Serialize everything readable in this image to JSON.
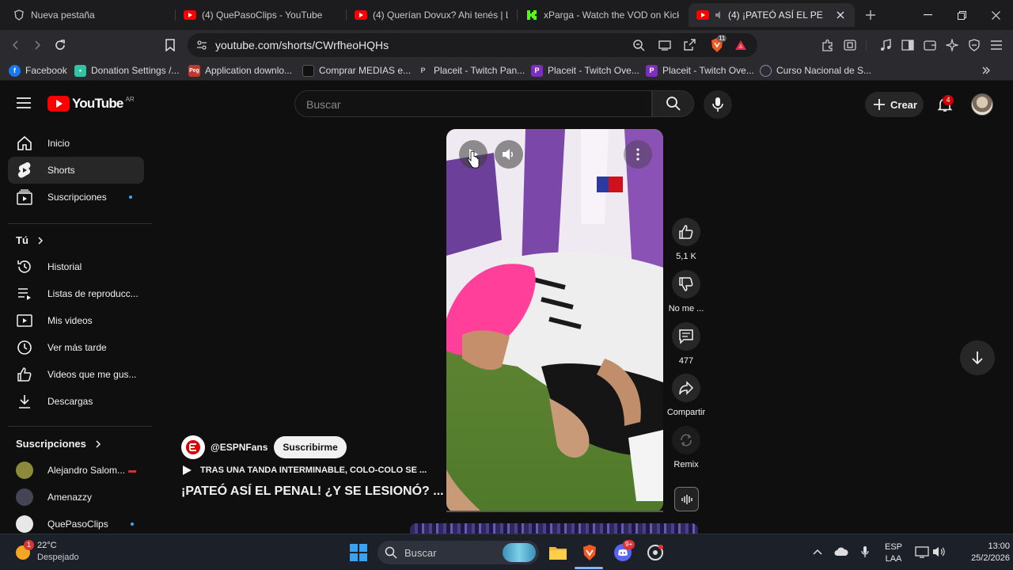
{
  "browser": {
    "tabs": [
      {
        "title": "Nueva pestaña",
        "favicon": "brave-shield-icon"
      },
      {
        "title": "(4) QuePasoClips - YouTube",
        "favicon": "youtube-icon"
      },
      {
        "title": "(4) Querían Dovux? Ahi tenés | La",
        "favicon": "youtube-icon"
      },
      {
        "title": "xParga - Watch the VOD on Kick",
        "favicon": "kick-icon"
      },
      {
        "title": "(4) ¡PATEÓ ASÍ EL PENAL!",
        "favicon": "youtube-icon",
        "active": true
      }
    ],
    "url": "youtube.com/shorts/CWrfheoHQHs",
    "brave_badge": "11",
    "bookmarks": [
      {
        "label": "Facebook",
        "icon": "facebook-icon",
        "color": "#1877f2"
      },
      {
        "label": "Donation Settings /...",
        "icon": "streamlabs-icon",
        "color": "#31c3a2"
      },
      {
        "label": "Application downlo...",
        "icon": "peg-icon",
        "color": "#c0392b"
      },
      {
        "label": "Comprar MEDIAS e...",
        "icon": "store-icon",
        "color": "#222222"
      },
      {
        "label": "Placeit - Twitch Pan...",
        "icon": "placeit-icon",
        "color": "#3a3a3a"
      },
      {
        "label": "Placeit - Twitch Ove...",
        "icon": "placeit-p-icon",
        "color": "#7b2fbf"
      },
      {
        "label": "Placeit - Twitch Ove...",
        "icon": "placeit-p-icon",
        "color": "#7b2fbf"
      },
      {
        "label": "Curso Nacional de S...",
        "icon": "seal-icon",
        "color": "#5a5a8a"
      }
    ]
  },
  "youtube": {
    "logo_text": "YouTube",
    "country": "AR",
    "search_placeholder": "Buscar",
    "create_label": "Crear",
    "notif_count": "4",
    "sidebar": {
      "main": [
        {
          "label": "Inicio",
          "icon": "home-icon"
        },
        {
          "label": "Shorts",
          "icon": "shorts-icon",
          "active": true
        },
        {
          "label": "Suscripciones",
          "icon": "subscriptions-icon",
          "dot": true
        }
      ],
      "you_heading": "Tú",
      "you": [
        {
          "label": "Historial",
          "icon": "history-icon"
        },
        {
          "label": "Listas de reproducc...",
          "icon": "playlists-icon"
        },
        {
          "label": "Mis videos",
          "icon": "my-videos-icon"
        },
        {
          "label": "Ver más tarde",
          "icon": "watch-later-icon"
        },
        {
          "label": "Videos que me gus...",
          "icon": "liked-icon"
        },
        {
          "label": "Descargas",
          "icon": "download-icon"
        }
      ],
      "subs_heading": "Suscripciones",
      "subs": [
        {
          "label": "Alejandro Salom...",
          "avatar_color": "#8a8a3a",
          "live": true
        },
        {
          "label": "Amenazzy",
          "avatar_color": "#444455"
        },
        {
          "label": "QuePasoClips",
          "avatar_color": "#e8e8e8",
          "dot": true
        }
      ]
    },
    "short": {
      "channel": "@ESPNFans",
      "subscribe": "Suscribirme",
      "playlist": "TRAS UNA TANDA INTERMINABLE, COLO-COLO SE ...",
      "title": "¡PATEÓ ASÍ EL PENAL! ¿Y SE LESIONÓ? ...",
      "likes": "5,1 K",
      "dislike_label": "No me ...",
      "comments": "477",
      "share_label": "Compartir",
      "remix_label": "Remix",
      "progress": 0.0
    }
  },
  "taskbar": {
    "weather_temp": "22°C",
    "weather_desc": "Despejado",
    "weather_badge": "1",
    "search_label": "Buscar",
    "lang_1": "ESP",
    "lang_2": "LAA",
    "time": "13:00",
    "date": "25/2/2026",
    "discord_badge": "9+"
  }
}
